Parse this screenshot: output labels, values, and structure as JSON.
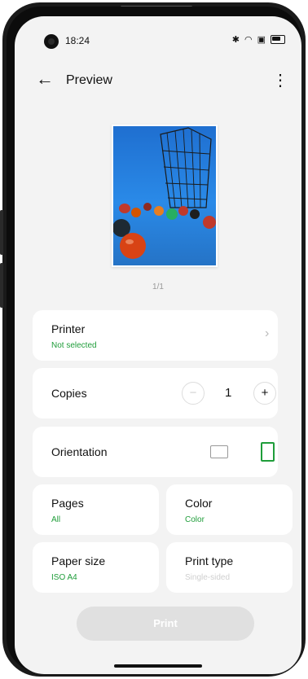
{
  "status": {
    "time": "18:24",
    "icons": [
      "bluetooth-icon",
      "wifi-icon",
      "sim-icon",
      "battery-icon"
    ]
  },
  "appbar": {
    "title": "Preview",
    "back_icon": "arrow-left-icon",
    "menu_icon": "more-vertical-icon"
  },
  "preview": {
    "page_indicator": "1/1"
  },
  "printer": {
    "label": "Printer",
    "value": "Not selected"
  },
  "copies": {
    "label": "Copies",
    "value": "1",
    "minus": "−",
    "plus": "+"
  },
  "orientation": {
    "label": "Orientation",
    "selected": "portrait"
  },
  "pages": {
    "label": "Pages",
    "value": "All"
  },
  "color": {
    "label": "Color",
    "value": "Color"
  },
  "paper_size": {
    "label": "Paper size",
    "value": "ISO A4"
  },
  "print_type": {
    "label": "Print type",
    "value": "Single-sided"
  },
  "print_button": {
    "label": "Print"
  },
  "colors": {
    "accent": "#1f9d3a",
    "background": "#f3f3f3",
    "card": "#ffffff",
    "button_disabled": "#e0e0e0"
  }
}
